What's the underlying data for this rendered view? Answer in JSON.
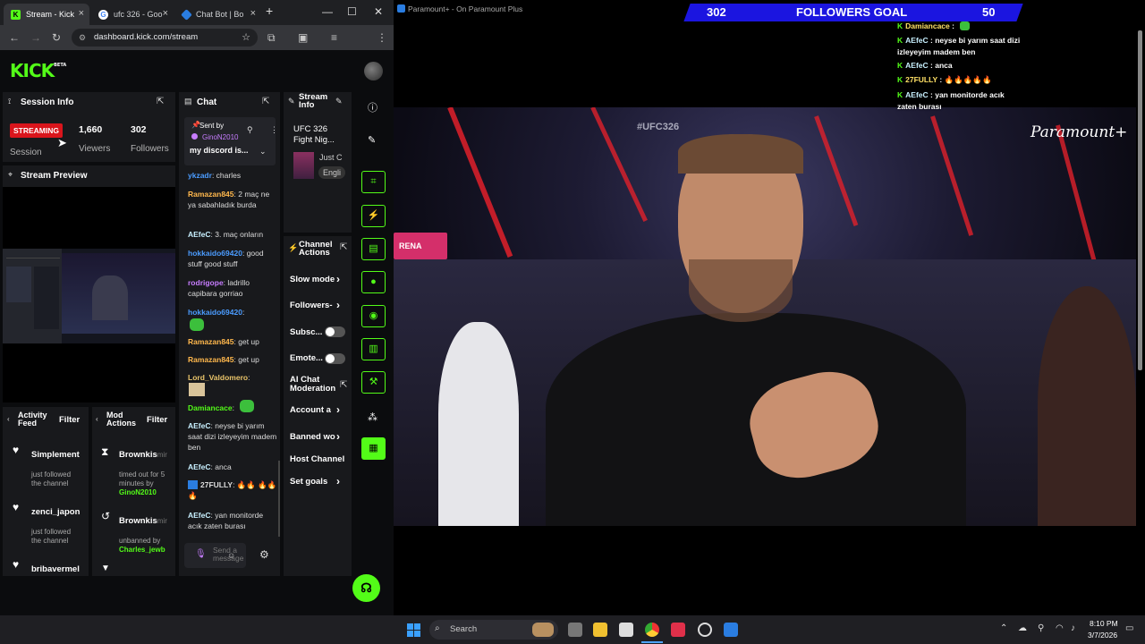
{
  "browser": {
    "tabs": [
      {
        "label": "Stream - Kick",
        "active": true,
        "icon": "K"
      },
      {
        "label": "ufc 326 - Goo",
        "icon": "G"
      },
      {
        "label": "Chat Bot | Bo",
        "icon": "B"
      }
    ],
    "new_tab": "+",
    "url": "dashboard.kick.com/stream",
    "profile_initial": "G",
    "window_controls": {
      "minimize": "—",
      "maximize": "☐",
      "close": "✕"
    }
  },
  "kick": {
    "logo": "KICK",
    "logo_sup": "BETA",
    "session": {
      "title": "Session Info",
      "status": "STREAMING",
      "status_label": "Session",
      "viewers_value": "1,660",
      "viewers_label": "Viewers",
      "followers_value": "302",
      "followers_label": "Followers"
    },
    "preview_title": "Stream Preview",
    "chat": {
      "title": "Chat",
      "pinned": {
        "sent_by_label": "Sent by",
        "user": "GinoN2010",
        "message": "my discord is..."
      },
      "messages": [
        {
          "user": "ykzadr",
          "text": "charles",
          "color": "#4b9cff"
        },
        {
          "user": "Ramazan845",
          "text": "2 maç ne ya sabahladık burda",
          "color": "#ffb84d"
        },
        {
          "user": "AEfeC",
          "text": "3. maç onların",
          "color": "#c8f0ff"
        },
        {
          "user": "hokkaido69420",
          "text": "good stuff good stuff",
          "color": "#4b9cff"
        },
        {
          "user": "rodrigope",
          "text": "ladrillo capibara gorriao",
          "color": "#c77dff"
        },
        {
          "user": "hokkaido69420",
          "text": "",
          "color": "#4b9cff"
        },
        {
          "user": "Ramazan845",
          "text": "get up",
          "color": "#ffb84d"
        },
        {
          "user": "Ramazan845",
          "text": "get up",
          "color": "#ffb84d"
        },
        {
          "user": "Lord_Valdomero",
          "text": "",
          "color": "#e9c46a"
        },
        {
          "user": "Damiancace",
          "text": "",
          "color": "#53fc18"
        },
        {
          "user": "AEfeC",
          "text": "neyse bi yarım saat dizi izleyeyim madem ben",
          "color": "#c8f0ff"
        },
        {
          "user": "AEfeC",
          "text": "anca",
          "color": "#c8f0ff"
        },
        {
          "user": "27FULLY",
          "text": "🔥🔥 🔥🔥🔥",
          "color": "#ffe066"
        },
        {
          "user": "AEfeC",
          "text": "yan monitorde acık zaten burası",
          "color": "#c8f0ff"
        }
      ],
      "input_placeholder": "Send a message"
    },
    "stream_info": {
      "title": "Stream Info",
      "stream_title": "UFC 326 Fight Nig...",
      "category": "Just C",
      "language": "Engli"
    },
    "channel_actions": {
      "title": "Channel Actions",
      "items": [
        "Slow mode",
        "Followers-",
        "Subsc...",
        "Emote...",
        "AI Chat Moderation",
        "Account a",
        "Banned wo",
        "Host Channel",
        "Set goals"
      ]
    },
    "activity": {
      "title": "Activity Feed",
      "filter": "Filter",
      "items": [
        {
          "name": "Simplement",
          "sub": "just followed the channel"
        },
        {
          "name": "zenci_japon",
          "sub": "just followed the channel"
        },
        {
          "name": "bribavermel",
          "sub": ""
        }
      ]
    },
    "mod": {
      "title": "Mod Actions",
      "filter": "Filter",
      "items": [
        {
          "name": "Brownkis",
          "suffix": "mir",
          "sub": "timed out for 5 minutes by",
          "by": "GinoN2010"
        },
        {
          "name": "Brownkis",
          "suffix": "mir",
          "sub": "unbanned by",
          "by": "Charles_jewb"
        }
      ]
    }
  },
  "video": {
    "window_title": "Paramount+ - On Paramount Plus",
    "brand": "Paramount+",
    "goal": {
      "current": "302",
      "label": "FOLLOWERS GOAL",
      "target": "50"
    },
    "overlay_chat": [
      {
        "user": "Damiancace",
        "text": ""
      },
      {
        "user": "AEfeC",
        "text": "neyse bi yarım saat dizi izleyeyim madem ben"
      },
      {
        "user": "AEfeC",
        "text": "anca"
      },
      {
        "user": "27FULLY",
        "text": "🔥🔥🔥🔥🔥"
      },
      {
        "user": "AEfeC",
        "text": "yan monitorde acık zaten burası"
      }
    ],
    "arena_sign": "#UFC326"
  },
  "taskbar": {
    "search": "Search",
    "time": "8:10 PM",
    "date": "3/7/2026"
  }
}
